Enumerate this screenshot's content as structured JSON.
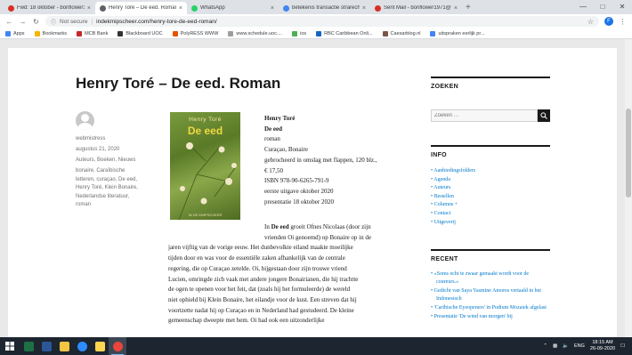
{
  "browser": {
    "tabs": [
      {
        "title": "Fwd: 18 oktober - bonflower1971@",
        "color": "#d93025",
        "active": false
      },
      {
        "title": "Henry Toré – De eed. Roman – i",
        "color": "#5f6368",
        "active": true
      },
      {
        "title": "WhatsApp",
        "color": "#25d366",
        "active": false
      },
      {
        "title": "betekenis transactie strarecht - G",
        "color": "#4285f4",
        "active": false
      },
      {
        "title": "Sent Mail - bonflower1971@gm",
        "color": "#d93025",
        "active": false
      }
    ],
    "new_tab": "+",
    "security_label": "Not secure",
    "url": "indekmipscheer.com/henry-tore-de-eed-roman/",
    "profile_initial": "F",
    "bookmarks": [
      {
        "label": "Apps",
        "color": "#4285f4"
      },
      {
        "label": "Bookmarks",
        "color": "#f4b400"
      },
      {
        "label": "MCB Bank",
        "color": "#c62828"
      },
      {
        "label": "Blackboard UOC",
        "color": "#333333"
      },
      {
        "label": "PolyRESS WWW",
        "color": "#e65100"
      },
      {
        "label": "www.schedule.uoc....",
        "color": "#9e9e9e"
      },
      {
        "label": "ios",
        "color": "#4caf50"
      },
      {
        "label": "RBC Caribbean Onli...",
        "color": "#1565c0"
      },
      {
        "label": "Caesarblog.nl",
        "color": "#795548"
      },
      {
        "label": "uitspraken eerlijk pr...",
        "color": "#4285f4"
      }
    ]
  },
  "post": {
    "title": "Henry Toré – De eed. Roman",
    "meta": {
      "author": "webmistress",
      "date": "augustus 21, 2020",
      "categories": "Auteurs, Boeken, Nieuws",
      "tags_lines": [
        "bonaire, Caraïbische",
        "letteren, curaçao, De eed,",
        "Henry Toré, Klein Bonaire,",
        "Nederlandse literatuur,",
        "roman"
      ]
    },
    "cover": {
      "author": "Henry Toré",
      "title": "De eed",
      "publisher": "IN DE KNIPSCHEER"
    },
    "details": [
      {
        "text": "Henry Toré",
        "bold": true
      },
      {
        "text": "De eed",
        "bold": true
      },
      {
        "text": "roman",
        "bold": false
      },
      {
        "text": "Curaçao, Bonaire",
        "bold": false
      },
      {
        "text": "gebrocheerd in omslag met flappen, 120 blz.,",
        "bold": false
      },
      {
        "text": "€ 17,50",
        "bold": false
      },
      {
        "text": "ISBN 978-90-6265-791-9",
        "bold": false
      },
      {
        "text": "eerste uitgave oktober 2020",
        "bold": false
      },
      {
        "text": "presentatie 18 oktober 2020",
        "bold": false
      }
    ],
    "body_intro": {
      "pre": "In ",
      "bold": "De eed",
      "post": " groeit Ofnes Nicolaas (door zijn"
    },
    "body_lines": [
      "vrienden Oi genoemd) op Bonaire op in de",
      "jaren vijftig van de vorige eeuw. Het dunbevolkte eiland maakte moeilijke",
      "tijden door en was voor de essentiële zaken afhankelijk van de centrale",
      "regering, die op Curaçao zetelde. Oi, bijgestaan door zijn trouwe vriend",
      "Lucien, omringde zich vaak met andere jongere Bonairianen, die hij trachtte",
      "de ogen te openen voor het feit, dat (zoals hij het formuleerde) de wereld",
      "niet ophield bij Klein Bonaire, het eilandje voor de kust. Een streven dat hij",
      "voortzette nadat hij op Curaçao en in Nederland had gestudeerd. De kleine",
      "gemeenschap dweepte met hem. Oi had ook een uitzonderlijke"
    ]
  },
  "sidebar": {
    "search_heading": "ZOEKEN",
    "search_placeholder": "Zoeken …",
    "info_heading": "INFO",
    "info_links": [
      "Aanbiedingsfolders",
      "Agenda",
      "Auteurs",
      "Bestellen",
      "Columns +",
      "Contact",
      "Uitgeverij"
    ],
    "recent_heading": "RECENT",
    "recent_links": [
      "«Soms echt te zwaar gemaakt wordt voor de coureurs.»",
      "Gedicht van Saya Yasmine Amores vertaald in het Indonesisch",
      "'Caribische Eyeopeners' in Podium Mozaiek afgelast",
      "Presentatie 'De wind van morgen' bij"
    ]
  },
  "taskbar": {
    "apps": [
      {
        "name": "excel-icon",
        "color": "#1e7145"
      },
      {
        "name": "word-icon",
        "color": "#2b5797"
      },
      {
        "name": "file-explorer-icon",
        "color": "#f4c542"
      },
      {
        "name": "edge-icon",
        "color": "#2d8cff"
      },
      {
        "name": "sticky-notes-icon",
        "color": "#ffd54f"
      },
      {
        "name": "chrome-icon",
        "color": "#e8453c"
      }
    ],
    "language": "ENG",
    "time": "18:15 AM",
    "date": "26-09-2020"
  }
}
